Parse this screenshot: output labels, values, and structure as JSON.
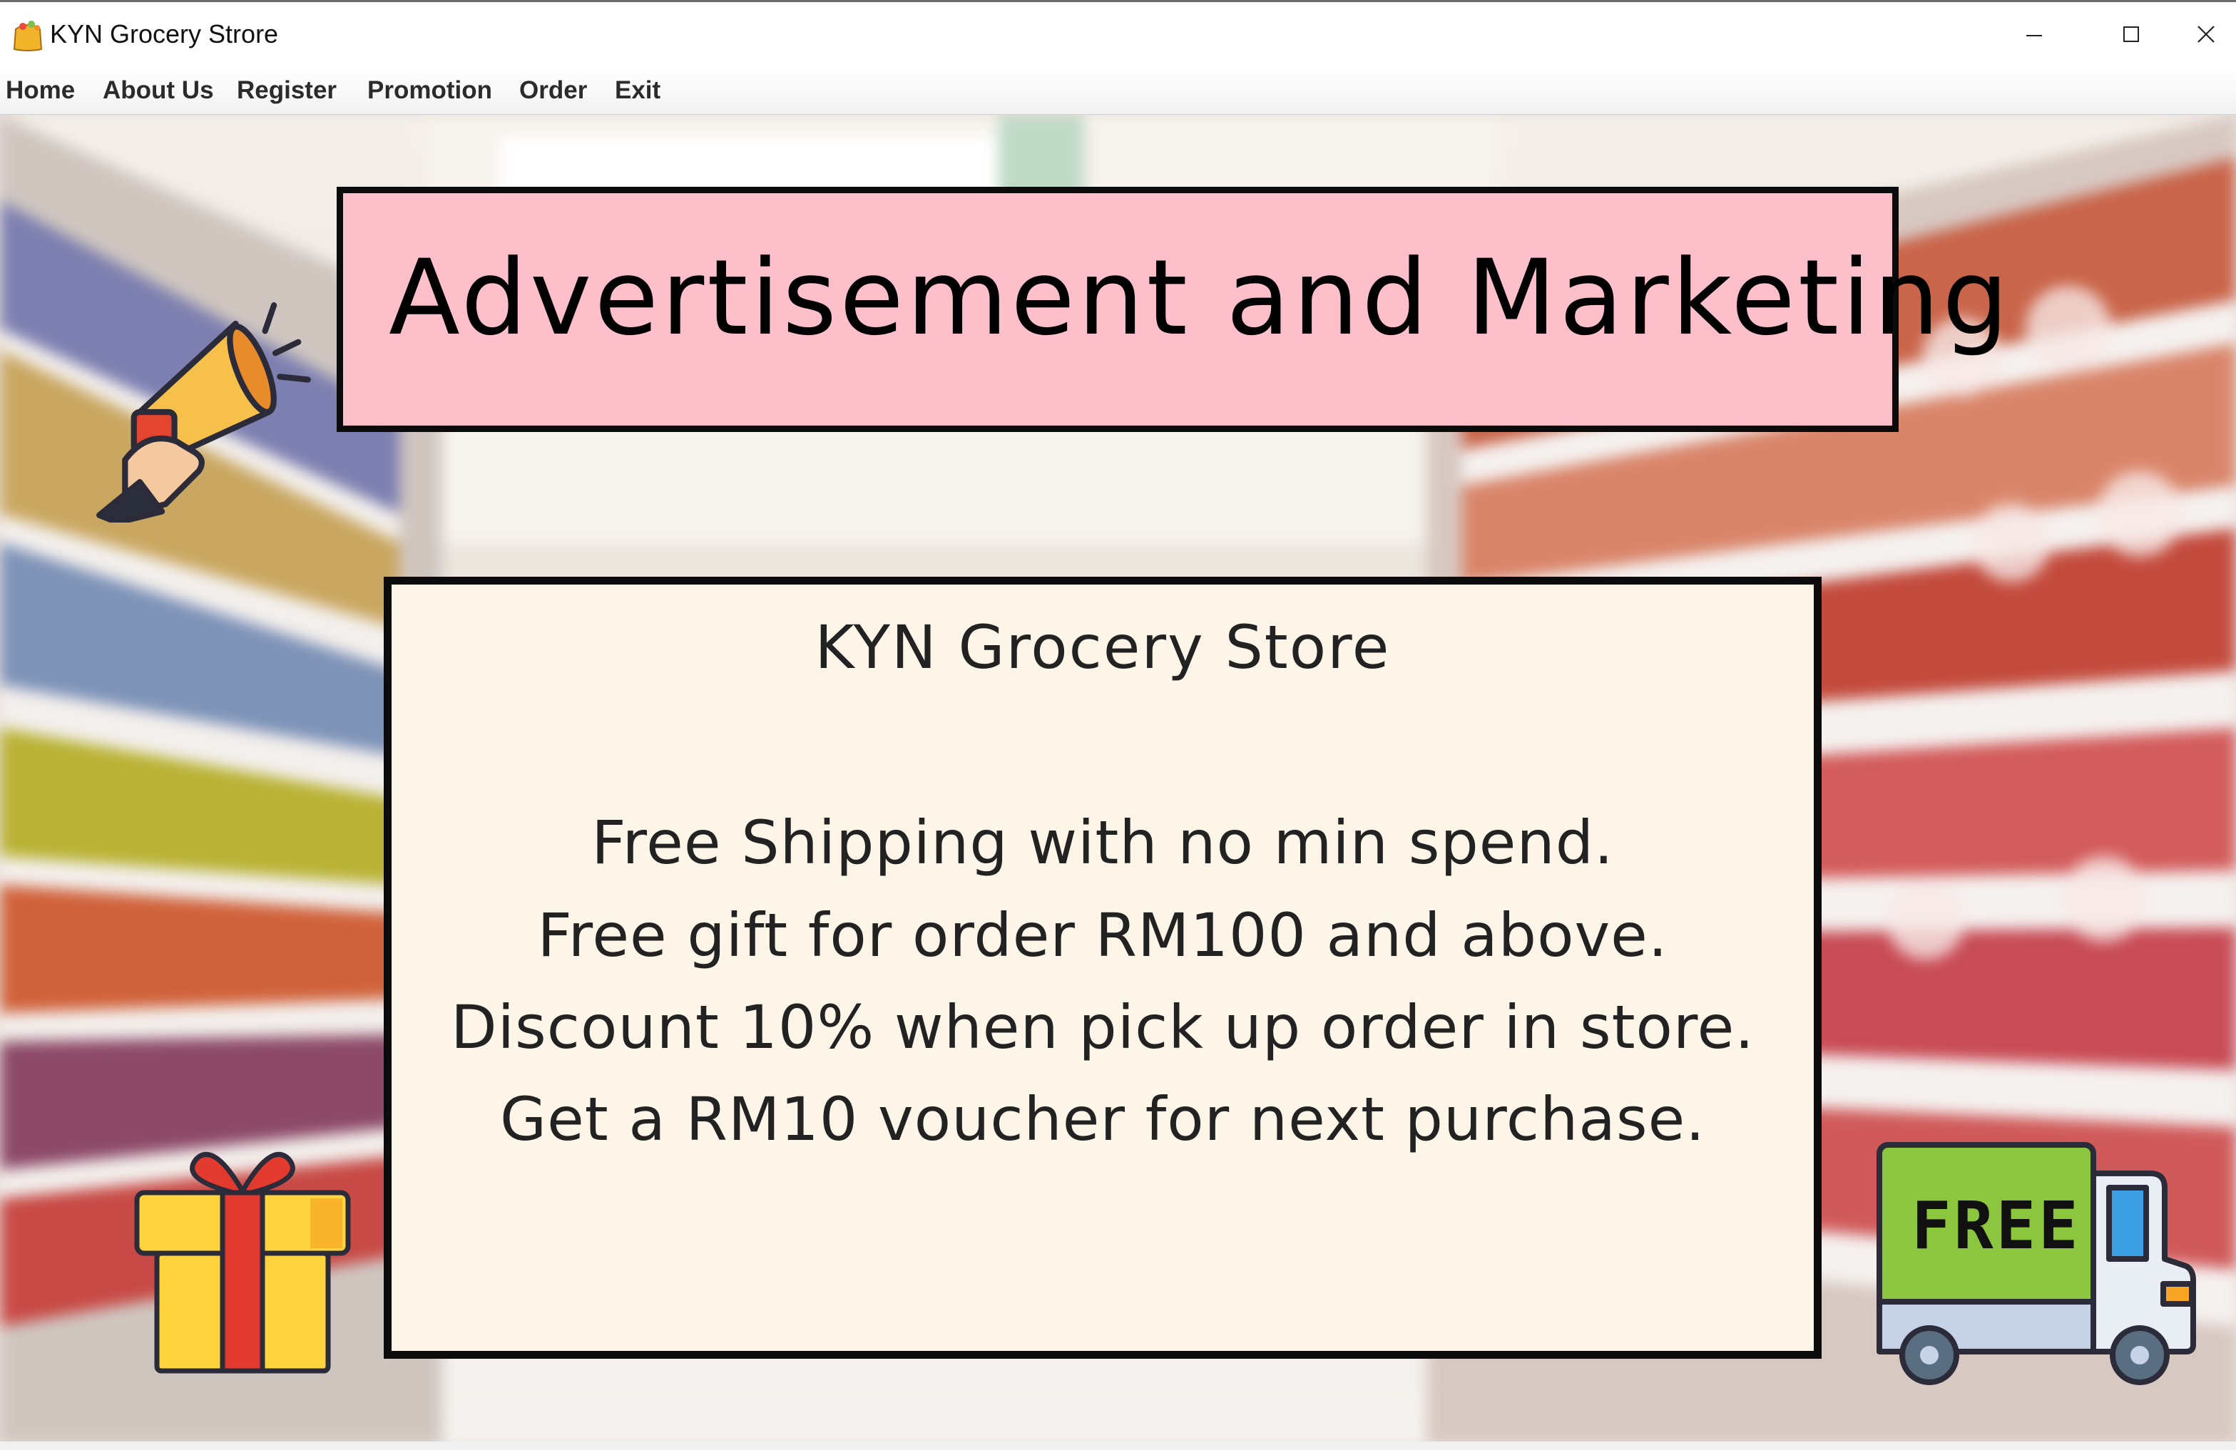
{
  "window": {
    "title": "KYN Grocery Strore",
    "app_icon": "grocery-bag-icon",
    "controls": {
      "minimize": "minimize-icon",
      "maximize": "maximize-icon",
      "close": "close-icon"
    }
  },
  "menu": {
    "items": [
      {
        "label": "Home"
      },
      {
        "label": "About Us"
      },
      {
        "label": "Register"
      },
      {
        "label": "Promotion"
      },
      {
        "label": "Order"
      },
      {
        "label": "Exit"
      }
    ]
  },
  "banner": {
    "headline": "Advertisement and Marketing",
    "headline_bg": "#fdc0cb",
    "icon": "megaphone-icon"
  },
  "promo": {
    "title": "KYN Grocery Store",
    "box_bg": "#fcf5e8",
    "lines": [
      "Free Shipping with no min spend.",
      "Free gift for order RM100 and above.",
      "Discount 10% when pick up order in store.",
      "Get a RM10 voucher for next purchase."
    ]
  },
  "decorations": {
    "gift": "gift-icon",
    "truck": "delivery-truck-icon",
    "truck_label": "FREE"
  }
}
